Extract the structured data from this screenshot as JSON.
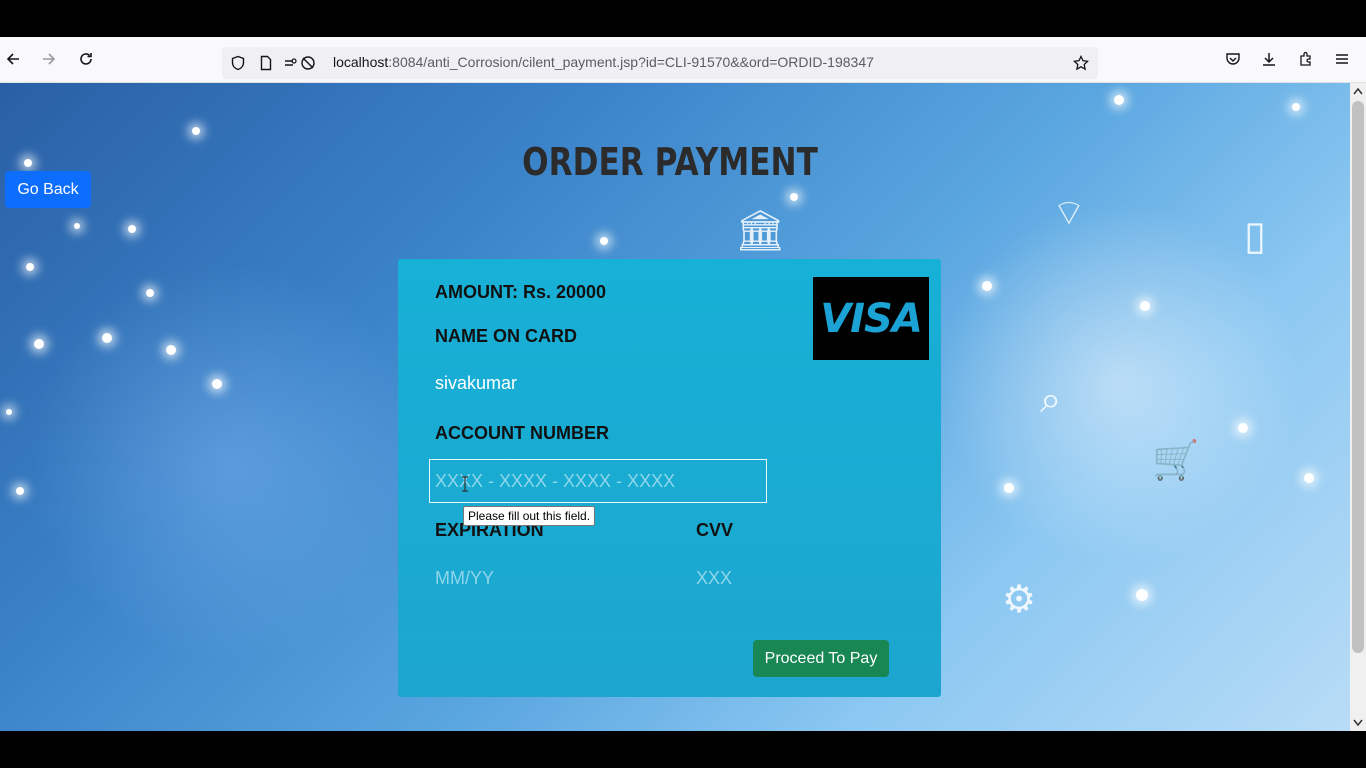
{
  "browser": {
    "url_host": "localhost",
    "url_rest": ":8084/anti_Corrosion/cilent_payment.jsp?id=CLI-91570&&ord=ORDID-198347"
  },
  "page": {
    "title": "ORDER PAYMENT",
    "go_back_label": "Go Back"
  },
  "card": {
    "amount_label": "AMOUNT: Rs. 20000",
    "name_label": "NAME ON CARD",
    "name_value": "sivakumar",
    "account_label": "ACCOUNT NUMBER",
    "account_placeholder": "XXXX - XXXX - XXXX - XXXX",
    "validation_tooltip": "Please fill out this field.",
    "expiration_label": "EXPIRATION",
    "expiration_placeholder": "MM/YY",
    "cvv_label": "CVV",
    "cvv_placeholder": "XXX",
    "brand_logo": "VISA",
    "proceed_label": "Proceed To Pay"
  }
}
